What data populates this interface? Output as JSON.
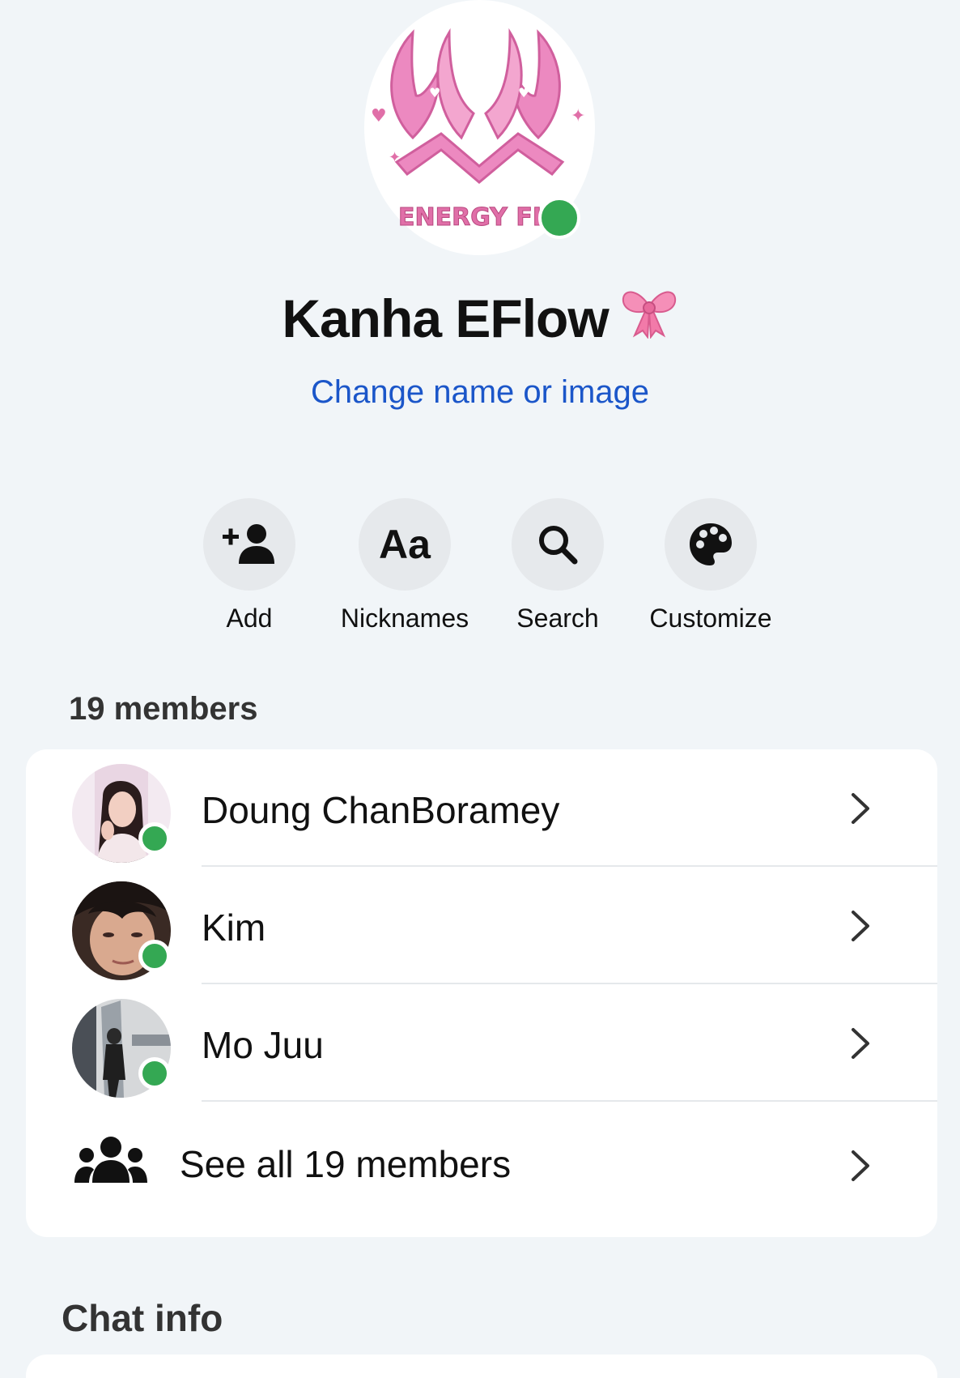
{
  "group": {
    "avatar_caption": "ENERGY FLC",
    "title": "Kanha EFlow",
    "title_emoji": "bow",
    "change_link": "Change name or image"
  },
  "actions": [
    {
      "label": "Add",
      "icon": "add-person-icon"
    },
    {
      "label": "Nicknames",
      "icon": "aa-text-icon",
      "glyph": "Aa"
    },
    {
      "label": "Search",
      "icon": "search-icon"
    },
    {
      "label": "Customize",
      "icon": "palette-icon"
    }
  ],
  "members": {
    "heading": "19 members",
    "list": [
      {
        "name": "Doung ChanBoramey",
        "online": true
      },
      {
        "name": "Kim",
        "online": true
      },
      {
        "name": "Mo Juu",
        "online": true
      }
    ],
    "see_all": "See all 19 members"
  },
  "chat_info": {
    "heading": "Chat info"
  },
  "colors": {
    "background": "#f1f5f8",
    "card": "#ffffff",
    "link": "#1b56c9",
    "online": "#34a853",
    "logo_pink": "#ec89c0"
  }
}
